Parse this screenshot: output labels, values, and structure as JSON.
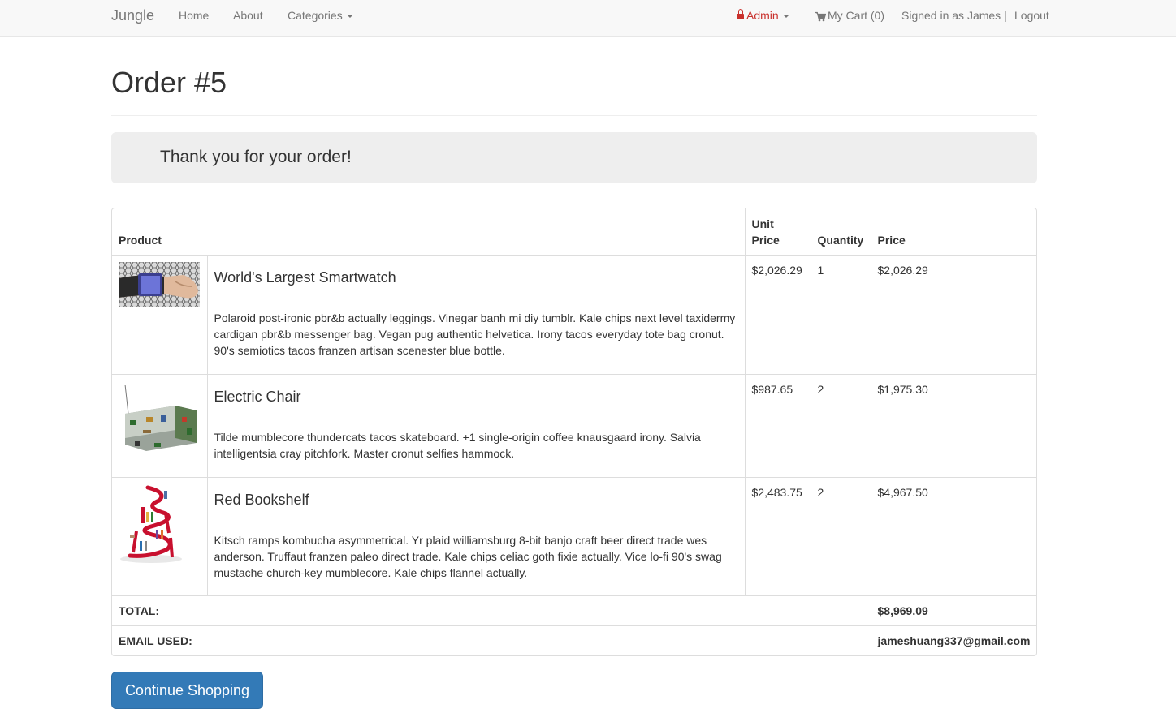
{
  "navbar": {
    "brand": "Jungle",
    "home": "Home",
    "about": "About",
    "categories": "Categories",
    "admin": "Admin",
    "cart": "My Cart (0)",
    "signed_in": "Signed in as James |",
    "logout": "Logout",
    "icons": {
      "admin": "lock-icon",
      "cart": "shopping-cart-icon"
    },
    "colors": {
      "admin": "#c9302c",
      "text": "#777777"
    }
  },
  "page": {
    "title": "Order #5",
    "thank_you": "Thank you for your order!"
  },
  "table": {
    "headers": {
      "product": "Product",
      "unit_price": "Unit Price",
      "quantity": "Quantity",
      "price": "Price"
    },
    "rows": [
      {
        "name": "World's Largest Smartwatch",
        "description": "Polaroid post-ironic pbr&b actually leggings. Vinegar banh mi diy tumblr. Kale chips next level taxidermy cardigan pbr&b messenger bag. Vegan pug authentic helvetica. Irony tacos everyday tote bag cronut. 90's semiotics tacos franzen artisan scenester blue bottle.",
        "unit_price": "$2,026.29",
        "quantity": "1",
        "price": "$2,026.29"
      },
      {
        "name": "Electric Chair",
        "description": "Tilde mumblecore thundercats tacos skateboard. +1 single-origin coffee knausgaard irony. Salvia intelligentsia cray pitchfork. Master cronut selfies hammock.",
        "unit_price": "$987.65",
        "quantity": "2",
        "price": "$1,975.30"
      },
      {
        "name": "Red Bookshelf",
        "description": "Kitsch ramps kombucha asymmetrical. Yr plaid williamsburg 8-bit banjo craft beer direct trade wes anderson. Truffaut franzen paleo direct trade. Kale chips celiac goth fixie actually. Vice lo-fi 90's swag mustache church-key mumblecore. Kale chips flannel actually.",
        "unit_price": "$2,483.75",
        "quantity": "2",
        "price": "$4,967.50"
      }
    ],
    "total_label": "TOTAL:",
    "total_value": "$8,969.09",
    "email_label": "EMAIL USED:",
    "email_value": "jameshuang337@gmail.com"
  },
  "actions": {
    "continue_shopping": "Continue Shopping",
    "button_color": "#337ab7"
  }
}
